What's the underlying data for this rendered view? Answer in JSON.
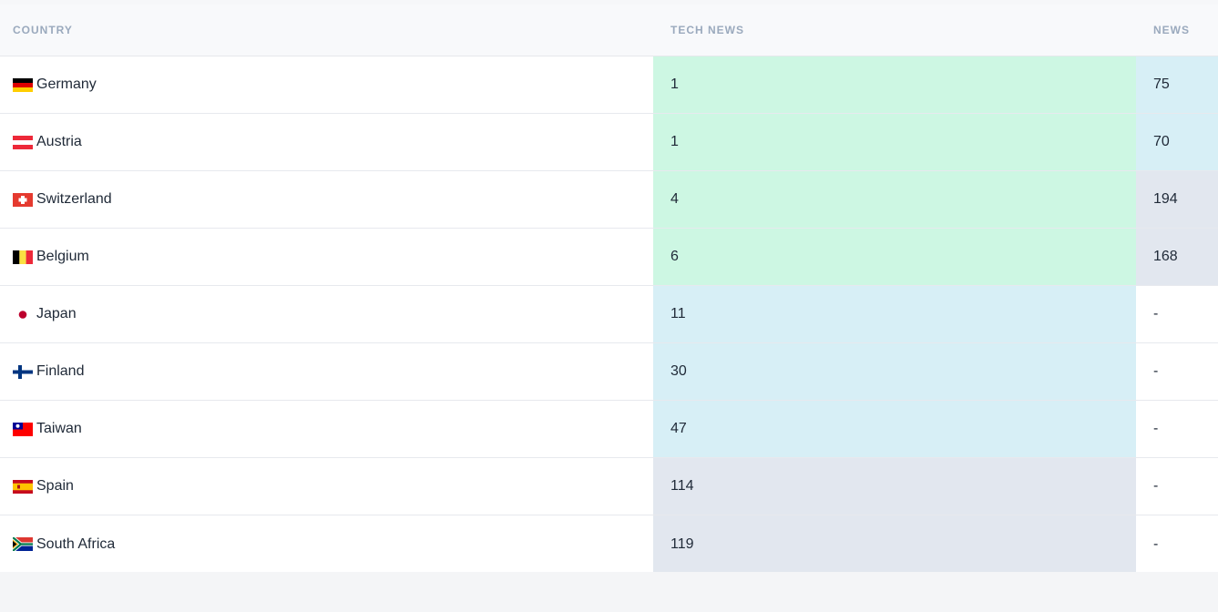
{
  "header": {
    "country": "COUNTRY",
    "tech_news": "TECH NEWS",
    "news": "NEWS"
  },
  "colors": {
    "green": "#cdf7e3",
    "blue": "#d7eff6",
    "gray": "#e2e7ef",
    "white": "#ffffff"
  },
  "rows": [
    {
      "country": "Germany",
      "flag": "germany-flag-icon",
      "tech_news": "1",
      "news": "75",
      "tech_color": "green",
      "news_color": "blue"
    },
    {
      "country": "Austria",
      "flag": "austria-flag-icon",
      "tech_news": "1",
      "news": "70",
      "tech_color": "green",
      "news_color": "blue"
    },
    {
      "country": "Switzerland",
      "flag": "switzerland-flag-icon",
      "tech_news": "4",
      "news": "194",
      "tech_color": "green",
      "news_color": "gray"
    },
    {
      "country": "Belgium",
      "flag": "belgium-flag-icon",
      "tech_news": "6",
      "news": "168",
      "tech_color": "green",
      "news_color": "gray"
    },
    {
      "country": "Japan",
      "flag": "japan-flag-icon",
      "tech_news": "11",
      "news": "-",
      "tech_color": "blue",
      "news_color": "white"
    },
    {
      "country": "Finland",
      "flag": "finland-flag-icon",
      "tech_news": "30",
      "news": "-",
      "tech_color": "blue",
      "news_color": "white"
    },
    {
      "country": "Taiwan",
      "flag": "taiwan-flag-icon",
      "tech_news": "47",
      "news": "-",
      "tech_color": "blue",
      "news_color": "white"
    },
    {
      "country": "Spain",
      "flag": "spain-flag-icon",
      "tech_news": "114",
      "news": "-",
      "tech_color": "gray",
      "news_color": "white"
    },
    {
      "country": "South Africa",
      "flag": "south-africa-flag-icon",
      "tech_news": "119",
      "news": "-",
      "tech_color": "gray",
      "news_color": "white"
    }
  ]
}
